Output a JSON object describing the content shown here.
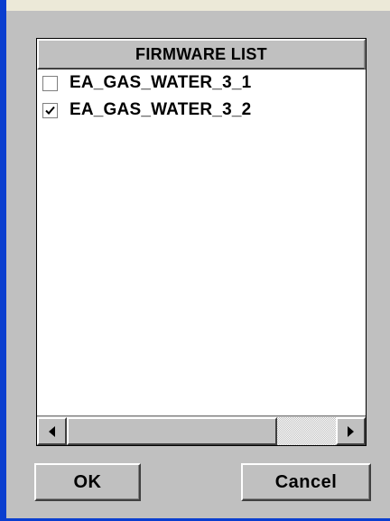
{
  "list": {
    "header": "FIRMWARE LIST",
    "items": [
      {
        "label": "EA_GAS_WATER_3_1",
        "checked": false
      },
      {
        "label": "EA_GAS_WATER_3_2",
        "checked": true
      }
    ]
  },
  "buttons": {
    "ok_label": "OK",
    "cancel_label": "Cancel"
  },
  "icons": {
    "scroll_left": "arrow-left-icon",
    "scroll_right": "arrow-right-icon",
    "check": "checkmark-icon"
  },
  "colors": {
    "frame_accent": "#0a3ecf",
    "dialog_face": "#c0c0c0"
  }
}
